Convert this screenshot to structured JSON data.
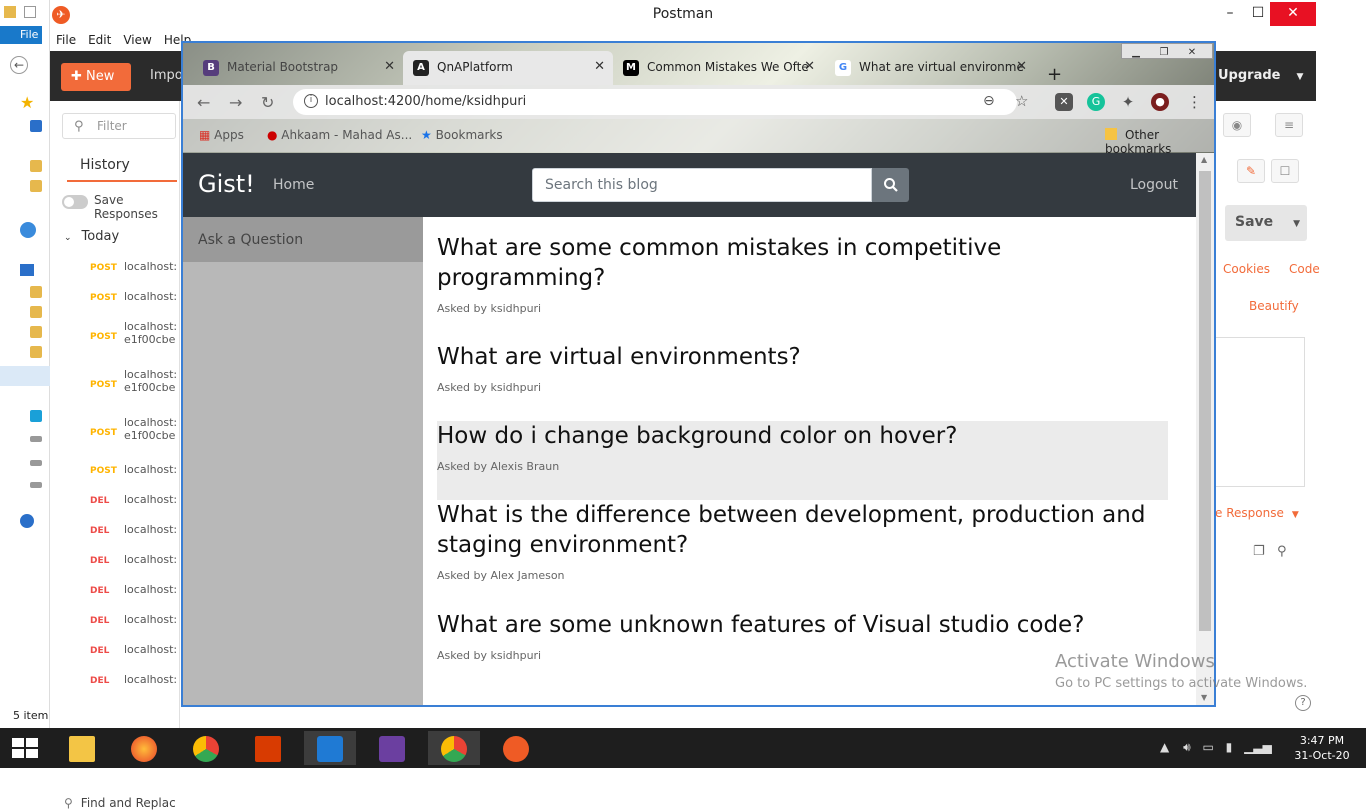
{
  "explorer": {
    "file_tab": "File",
    "items_count": "5 item"
  },
  "postman": {
    "title": "Postman",
    "menu": [
      "File",
      "Edit",
      "View",
      "Help"
    ],
    "new_label": "New",
    "import_label": "Impo",
    "upgrade_label": "Upgrade",
    "filter_placeholder": "Filter",
    "history_tab": "History",
    "save_responses": "Save Responses",
    "today_label": "Today",
    "history": [
      {
        "method": "POST",
        "url": "localhost:"
      },
      {
        "method": "POST",
        "url": "localhost:"
      },
      {
        "method": "POST",
        "url": "localhost:",
        "url2": "e1f00cbe"
      },
      {
        "method": "POST",
        "url": "localhost:",
        "url2": "e1f00cbe"
      },
      {
        "method": "POST",
        "url": "localhost:",
        "url2": "e1f00cbe"
      },
      {
        "method": "POST",
        "url": "localhost:"
      },
      {
        "method": "DEL",
        "url": "localhost:"
      },
      {
        "method": "DEL",
        "url": "localhost:"
      },
      {
        "method": "DEL",
        "url": "localhost:"
      },
      {
        "method": "DEL",
        "url": "localhost:"
      },
      {
        "method": "DEL",
        "url": "localhost:"
      },
      {
        "method": "DEL",
        "url": "localhost:"
      },
      {
        "method": "DEL",
        "url": "localhost:"
      }
    ],
    "find_replace": "Find and Replac",
    "save_label": "Save",
    "cookies": "Cookies",
    "code": "Code",
    "beautify": "Beautify",
    "save_response": "e Response"
  },
  "chrome": {
    "tabs": [
      {
        "title": "Material Bootstrap",
        "icon": "B"
      },
      {
        "title": "QnAPlatform",
        "icon": "A"
      },
      {
        "title": "Common Mistakes We Ofte",
        "icon": "M"
      },
      {
        "title": "What are virtual environme",
        "icon": "G"
      }
    ],
    "url": "localhost:4200/home/ksidhpuri",
    "bookmarks": [
      "Apps",
      "Ahkaam - Mahad As...",
      "Bookmarks"
    ],
    "other_bookmarks": "Other bookmarks"
  },
  "page": {
    "brand": "Gist!",
    "nav_home": "Home",
    "search_placeholder": "Search this blog",
    "logout": "Logout",
    "sidebar_item": "Ask a Question",
    "posts": [
      {
        "question": "What are some common mistakes in competitive programming?",
        "asked_by": "Asked by ksidhpuri"
      },
      {
        "question": "What are virtual environments?",
        "asked_by": "Asked by ksidhpuri"
      },
      {
        "question": "How do i change background color on hover?",
        "asked_by": "Asked by Alexis Braun"
      },
      {
        "question": "What is the difference between development, production and staging environment?",
        "asked_by": "Asked by Alex Jameson"
      },
      {
        "question": "What are some unknown features of Visual studio code?",
        "asked_by": "Asked by ksidhpuri"
      }
    ]
  },
  "watermark": {
    "line1": "Activate Windows",
    "line2": "Go to PC settings to activate Windows."
  },
  "taskbar": {
    "time": "3:47 PM",
    "date": "31-Oct-20"
  },
  "colors": {
    "postman_orange": "#f26b3a",
    "navbar_dark": "#343a40",
    "chrome_border": "#3a7fd5"
  }
}
